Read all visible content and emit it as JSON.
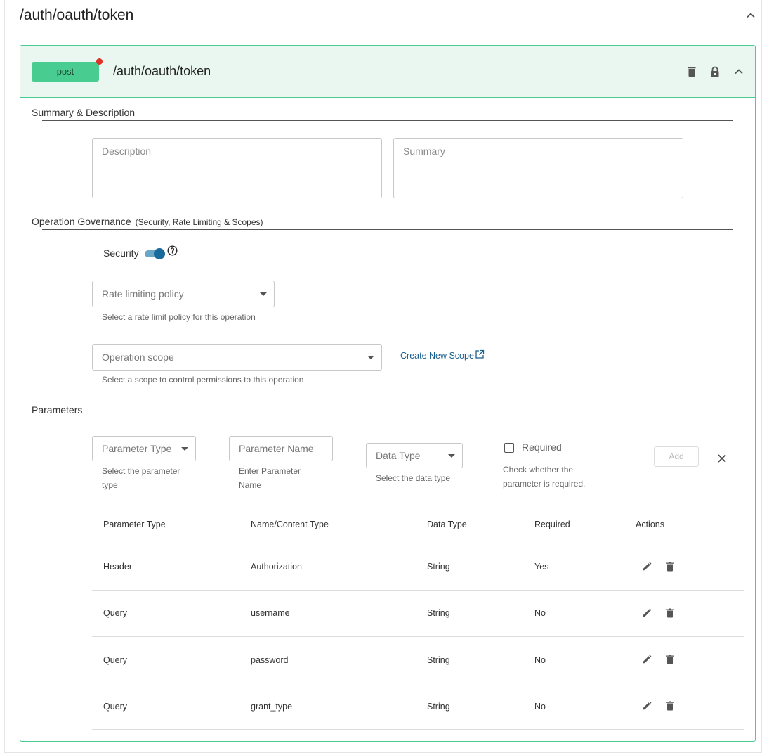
{
  "resource": {
    "title": "/auth/oauth/token"
  },
  "operation": {
    "method": "post",
    "path": "/auth/oauth/token",
    "colors": {
      "method": "#49cc90",
      "header_bg": "#e9f7f0",
      "indicator": "#e0302a"
    },
    "header_icons": [
      "trash-icon",
      "lock-icon",
      "chevron-up-icon"
    ]
  },
  "summary_section": {
    "title": "Summary & Description",
    "description_placeholder": "Description",
    "summary_placeholder": "Summary"
  },
  "governance": {
    "title": "Operation Governance",
    "subtitle": "(Security, Rate Limiting & Scopes)",
    "security_label": "Security",
    "security_enabled": true,
    "rate_limit": {
      "placeholder": "Rate limiting policy",
      "helper": "Select a rate limit policy for this operation"
    },
    "scope": {
      "placeholder": "Operation scope",
      "helper": "Select a scope to control permissions to this operation"
    },
    "create_scope_link": "Create New Scope"
  },
  "parameters": {
    "title": "Parameters",
    "form": {
      "param_type": {
        "placeholder": "Parameter Type",
        "helper_line1": "Select the parameter",
        "helper_line2": "type"
      },
      "param_name": {
        "placeholder": "Parameter Name",
        "helper_line1": "Enter Parameter",
        "helper_line2": "Name"
      },
      "data_type": {
        "placeholder": "Data Type",
        "helper": "Select the data type"
      },
      "required": {
        "label": "Required",
        "checked": false,
        "helper_line1": "Check whether the",
        "helper_line2": "parameter is required."
      },
      "add_label": "Add"
    },
    "table": {
      "headers": [
        "Parameter Type",
        "Name/Content Type",
        "Data Type",
        "Required",
        "Actions"
      ],
      "rows": [
        {
          "type": "Header",
          "name": "Authorization",
          "data_type": "String",
          "required": "Yes"
        },
        {
          "type": "Query",
          "name": "username",
          "data_type": "String",
          "required": "No"
        },
        {
          "type": "Query",
          "name": "password",
          "data_type": "String",
          "required": "No"
        },
        {
          "type": "Query",
          "name": "grant_type",
          "data_type": "String",
          "required": "No"
        }
      ]
    }
  }
}
